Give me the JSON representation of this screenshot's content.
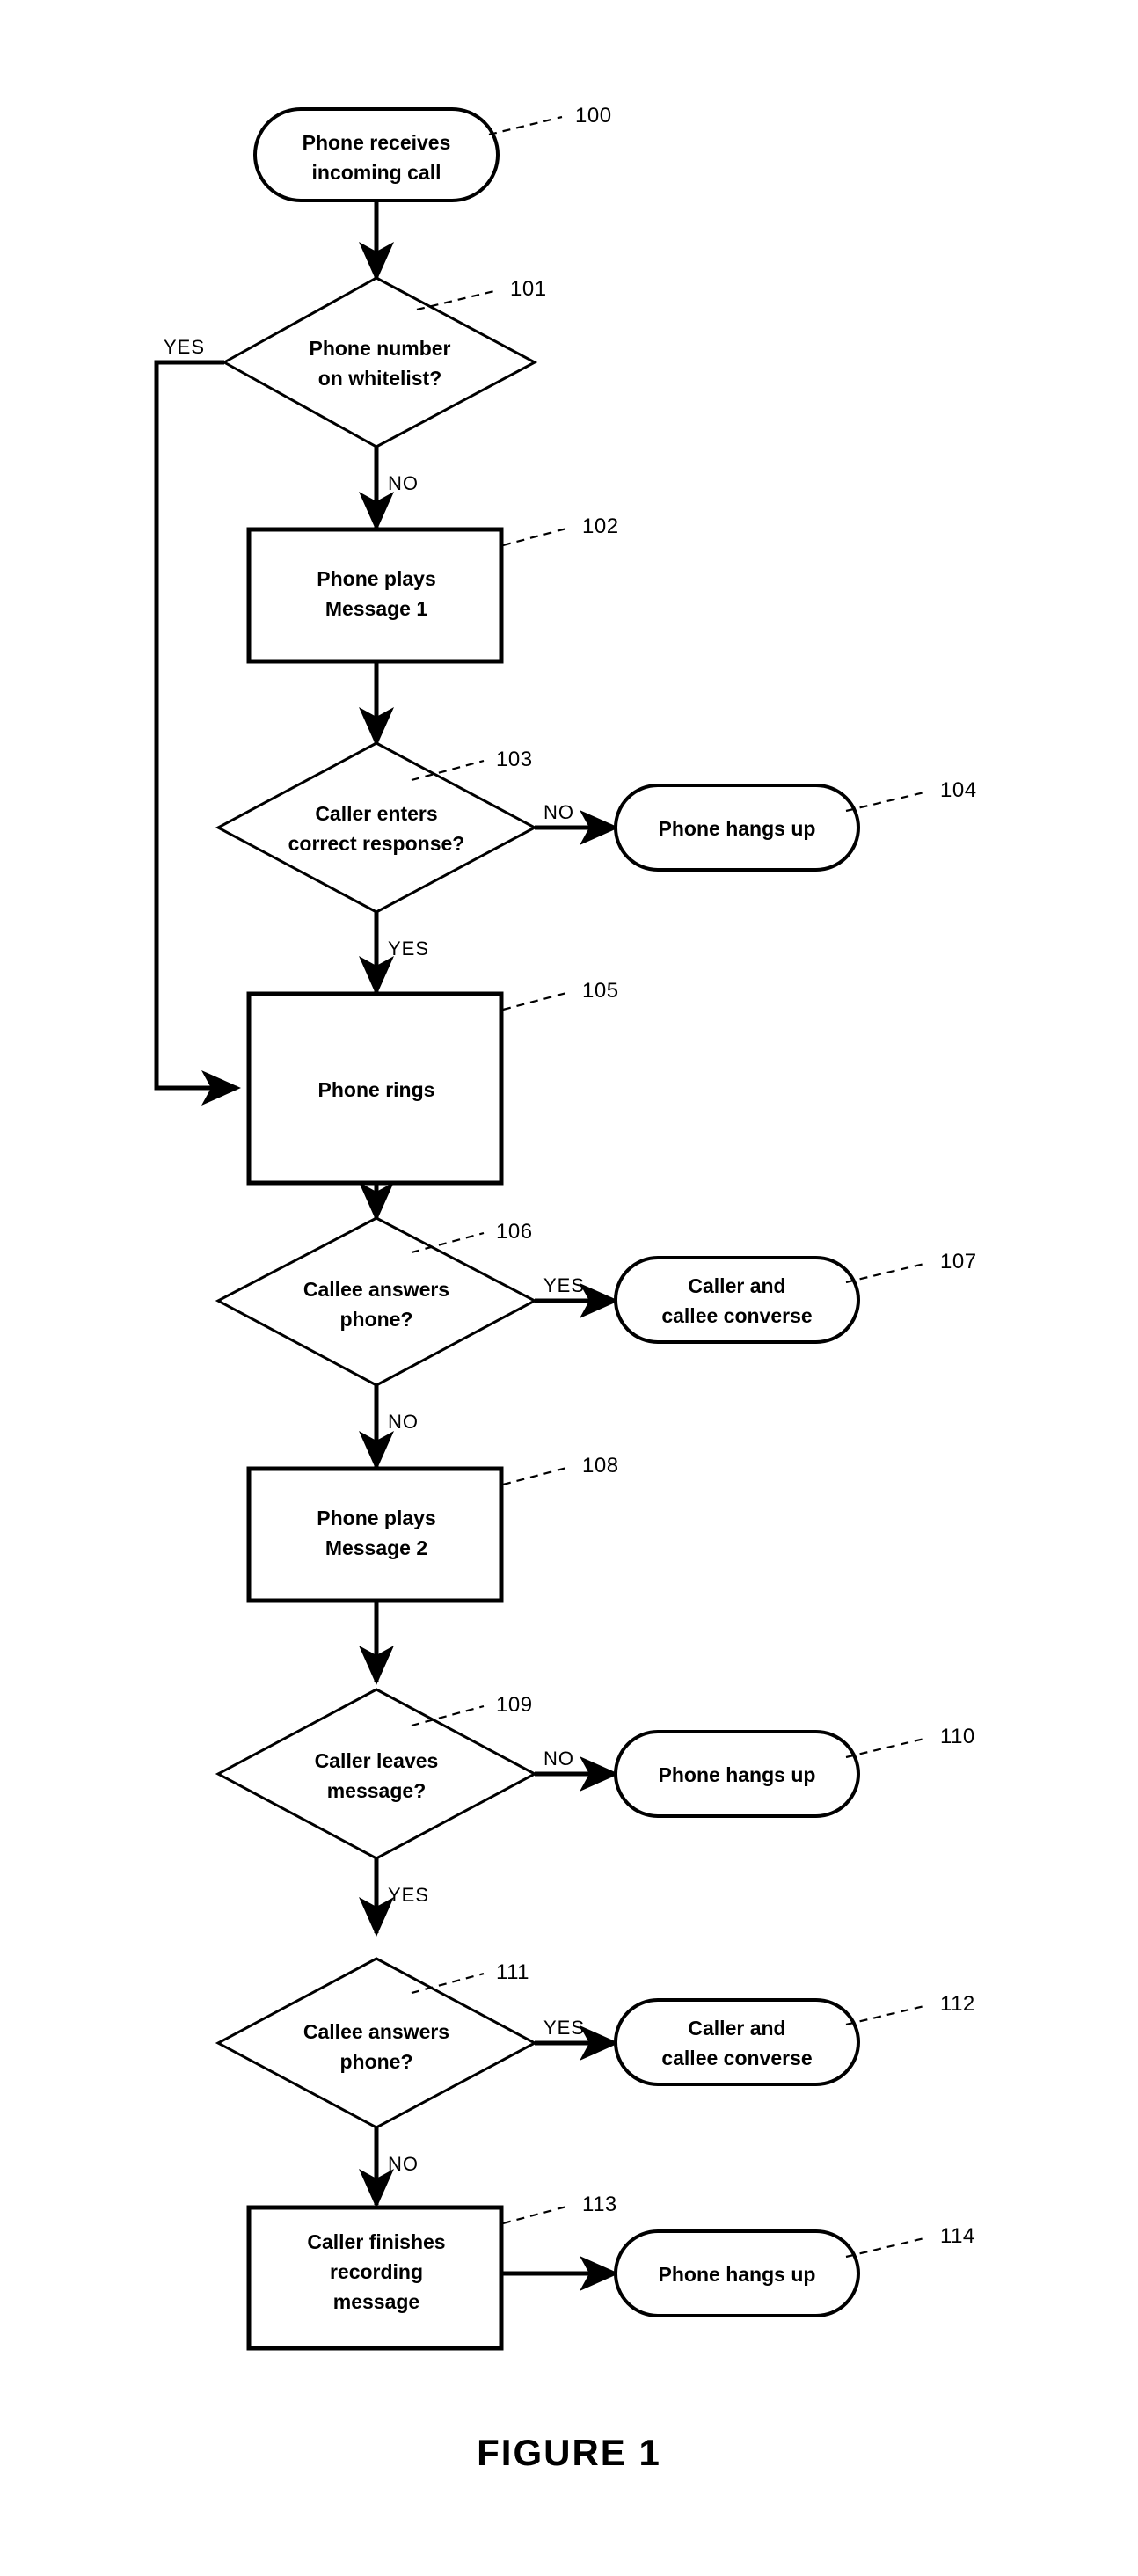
{
  "figure": {
    "caption": "FIGURE 1"
  },
  "chart_data": {
    "type": "diagram",
    "diagram_kind": "flowchart",
    "title": "FIGURE 1",
    "nodes": [
      {
        "ref": "100",
        "shape": "terminator",
        "lines": [
          "Phone receives",
          "incoming call"
        ]
      },
      {
        "ref": "101",
        "shape": "decision",
        "lines": [
          "Phone number",
          "on whitelist?"
        ]
      },
      {
        "ref": "102",
        "shape": "process",
        "lines": [
          "Phone plays",
          "Message 1"
        ]
      },
      {
        "ref": "103",
        "shape": "decision",
        "lines": [
          "Caller enters",
          "correct response?"
        ]
      },
      {
        "ref": "104",
        "shape": "terminator",
        "lines": [
          "Phone hangs up"
        ]
      },
      {
        "ref": "105",
        "shape": "process",
        "lines": [
          "Phone rings"
        ]
      },
      {
        "ref": "106",
        "shape": "decision",
        "lines": [
          "Callee answers",
          "phone?"
        ]
      },
      {
        "ref": "107",
        "shape": "terminator",
        "lines": [
          "Caller and",
          "callee converse"
        ]
      },
      {
        "ref": "108",
        "shape": "process",
        "lines": [
          "Phone plays",
          "Message 2"
        ]
      },
      {
        "ref": "109",
        "shape": "decision",
        "lines": [
          "Caller leaves",
          "message?"
        ]
      },
      {
        "ref": "110",
        "shape": "terminator",
        "lines": [
          "Phone hangs up"
        ]
      },
      {
        "ref": "111",
        "shape": "decision",
        "lines": [
          "Callee answers",
          "phone?"
        ]
      },
      {
        "ref": "112",
        "shape": "terminator",
        "lines": [
          "Caller and",
          "callee converse"
        ]
      },
      {
        "ref": "113",
        "shape": "process",
        "lines": [
          "Caller finishes",
          "recording",
          "message"
        ]
      },
      {
        "ref": "114",
        "shape": "terminator",
        "lines": [
          "Phone hangs up"
        ]
      }
    ],
    "edges": [
      {
        "from": "100",
        "to": "101",
        "label": ""
      },
      {
        "from": "101",
        "to": "105",
        "label": "YES"
      },
      {
        "from": "101",
        "to": "102",
        "label": "NO"
      },
      {
        "from": "102",
        "to": "103",
        "label": ""
      },
      {
        "from": "103",
        "to": "104",
        "label": "NO"
      },
      {
        "from": "103",
        "to": "105",
        "label": "YES"
      },
      {
        "from": "105",
        "to": "106",
        "label": ""
      },
      {
        "from": "106",
        "to": "107",
        "label": "YES"
      },
      {
        "from": "106",
        "to": "108",
        "label": "NO"
      },
      {
        "from": "108",
        "to": "109",
        "label": ""
      },
      {
        "from": "109",
        "to": "110",
        "label": "NO"
      },
      {
        "from": "109",
        "to": "111",
        "label": "YES"
      },
      {
        "from": "111",
        "to": "112",
        "label": "YES"
      },
      {
        "from": "111",
        "to": "113",
        "label": "NO"
      },
      {
        "from": "113",
        "to": "114",
        "label": ""
      }
    ]
  },
  "nodes": {
    "n100": {
      "ref": "100",
      "line1": "Phone receives",
      "line2": "incoming call"
    },
    "n101": {
      "ref": "101",
      "line1": "Phone number",
      "line2": "on whitelist?"
    },
    "n102": {
      "ref": "102",
      "line1": "Phone plays",
      "line2": "Message 1"
    },
    "n103": {
      "ref": "103",
      "line1": "Caller enters",
      "line2": "correct response?"
    },
    "n104": {
      "ref": "104",
      "line1": "Phone hangs up"
    },
    "n105": {
      "ref": "105",
      "line1": "Phone rings"
    },
    "n106": {
      "ref": "106",
      "line1": "Callee answers",
      "line2": "phone?"
    },
    "n107": {
      "ref": "107",
      "line1": "Caller and",
      "line2": "callee converse"
    },
    "n108": {
      "ref": "108",
      "line1": "Phone plays",
      "line2": "Message 2"
    },
    "n109": {
      "ref": "109",
      "line1": "Caller leaves",
      "line2": "message?"
    },
    "n110": {
      "ref": "110",
      "line1": "Phone hangs up"
    },
    "n111": {
      "ref": "111",
      "line1": "Callee answers",
      "line2": "phone?"
    },
    "n112": {
      "ref": "112",
      "line1": "Caller and",
      "line2": "callee converse"
    },
    "n113": {
      "ref": "113",
      "line1": "Caller finishes",
      "line2": "recording",
      "line3": "message"
    },
    "n114": {
      "ref": "114",
      "line1": "Phone hangs up"
    }
  },
  "edge_labels": {
    "e101_yes": "YES",
    "e101_no": "NO",
    "e103_no": "NO",
    "e103_yes": "YES",
    "e106_yes": "YES",
    "e106_no": "NO",
    "e109_no": "NO",
    "e109_yes": "YES",
    "e111_yes": "YES",
    "e111_no": "NO"
  },
  "colors": {
    "ink": "#000000",
    "paper": "#ffffff"
  }
}
